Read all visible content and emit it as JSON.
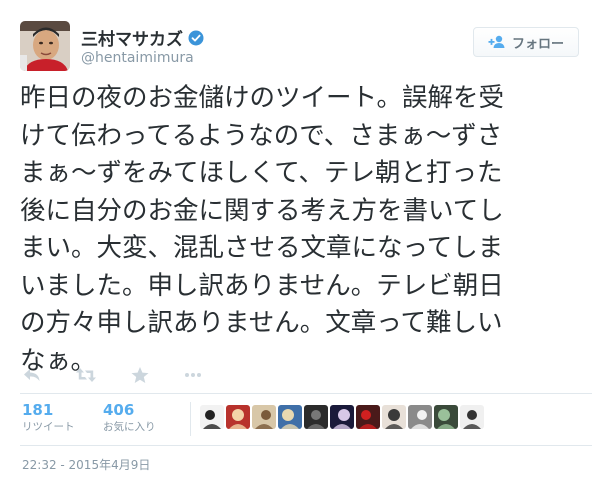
{
  "user": {
    "display_name": "三村マサカズ",
    "screen_name": "@hentaimimura",
    "verified_icon": "verified-badge-icon"
  },
  "follow_button": {
    "label": "フォロー",
    "icon": "follow-user-icon"
  },
  "tweet": {
    "lines": [
      "昨日の夜のお金儲けのツイート。誤解を受",
      "けて伝わってるようなので、さまぁ～ずさ",
      "まぁ～ずをみてほしくて、テレ朝と打った",
      "後に自分のお金に関する考え方を書いてし",
      "まい。大変、混乱させる文章になってしま",
      "いました。申し訳ありません。テレビ朝日",
      "の方々申し訳ありません。文章って難しい",
      "なぁ。"
    ]
  },
  "actions": [
    "reply-icon",
    "retweet-icon",
    "favorite-icon",
    "more-icon"
  ],
  "stats": {
    "retweets": {
      "count": "181",
      "label": "リツイート"
    },
    "favorites": {
      "count": "406",
      "label": "お気に入り"
    }
  },
  "favoriter_avatars": [
    {
      "name": "avatar-1",
      "bg": "#f2f2f2",
      "fg": "#222222"
    },
    {
      "name": "avatar-2",
      "bg": "#b8322c",
      "fg": "#f3d3a8"
    },
    {
      "name": "avatar-3",
      "bg": "#d8c7a8",
      "fg": "#7a5a3a"
    },
    {
      "name": "avatar-4",
      "bg": "#3f6fa8",
      "fg": "#e8d8b0"
    },
    {
      "name": "avatar-5",
      "bg": "#2b2b2b",
      "fg": "#777777"
    },
    {
      "name": "avatar-6",
      "bg": "#1a1a3a",
      "fg": "#d8c8e8"
    },
    {
      "name": "avatar-7",
      "bg": "#4a1a1a",
      "fg": "#d02020"
    },
    {
      "name": "avatar-8",
      "bg": "#e8e0d8",
      "fg": "#3a3a3a"
    },
    {
      "name": "avatar-9",
      "bg": "#8a8a8a",
      "fg": "#f2f2f2"
    },
    {
      "name": "avatar-10",
      "bg": "#3a4a3a",
      "fg": "#9ac09a"
    },
    {
      "name": "avatar-11",
      "bg": "#f0f0f0",
      "fg": "#333333"
    }
  ],
  "timestamp": "22:32 - 2015年4月9日",
  "colors": {
    "text": "#292f33",
    "muted": "#8899a6",
    "link": "#55acee",
    "border": "#e1e8ed",
    "verified": "#3b94d9",
    "action_icon": "#ccd6dd"
  }
}
